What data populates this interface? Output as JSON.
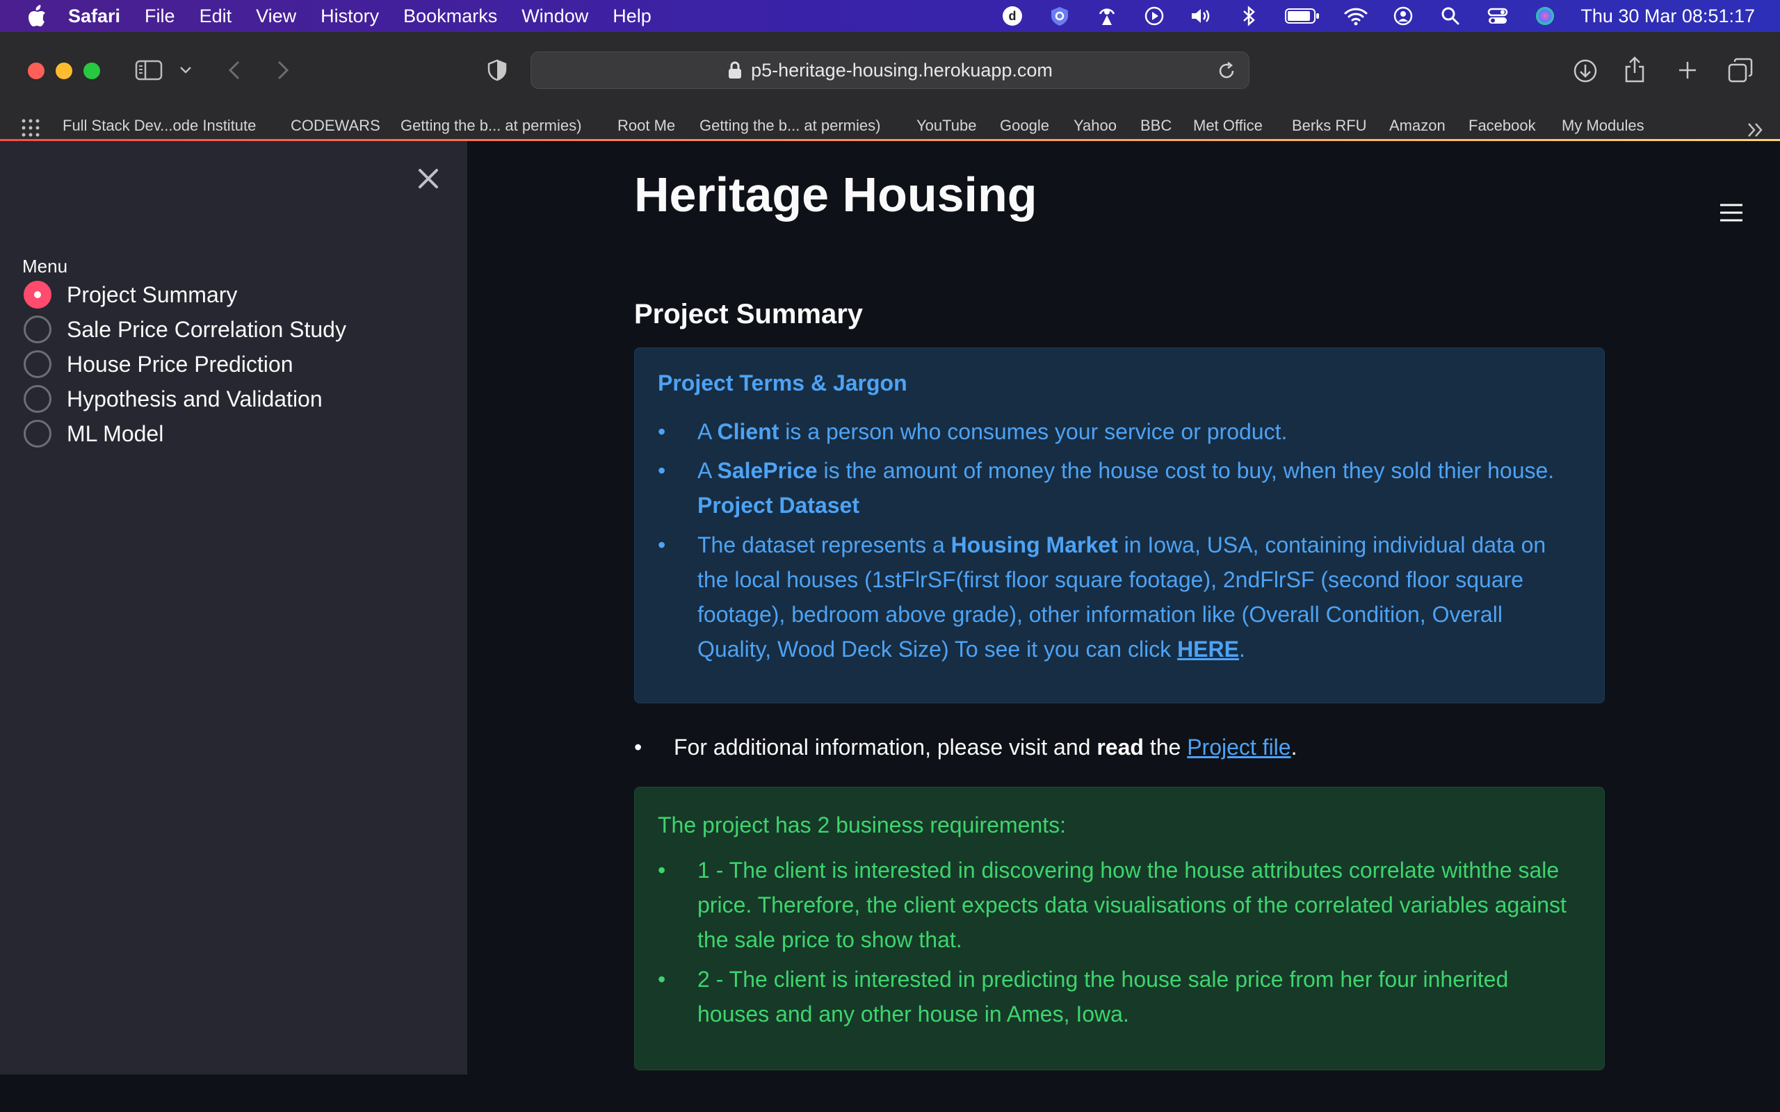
{
  "menubar": {
    "app_name": "Safari",
    "menus": [
      "File",
      "Edit",
      "View",
      "History",
      "Bookmarks",
      "Window",
      "Help"
    ],
    "clock": "Thu 30 Mar  08:51:17"
  },
  "browser": {
    "url": "p5-heritage-housing.herokuapp.com",
    "bookmarks": [
      "Full Stack Dev...ode Institute",
      "CODEWARS",
      "Getting the b... at permies)",
      "Root Me",
      "Getting the b... at permies)",
      "YouTube",
      "Google",
      "Yahoo",
      "BBC",
      "Met Office",
      "Berks RFU",
      "Amazon",
      "Facebook",
      "My Modules"
    ]
  },
  "sidebar": {
    "menu_label": "Menu",
    "items": [
      {
        "label": "Project Summary",
        "selected": true
      },
      {
        "label": "Sale Price Correlation Study",
        "selected": false
      },
      {
        "label": "House Price Prediction",
        "selected": false
      },
      {
        "label": "Hypothesis and Validation",
        "selected": false
      },
      {
        "label": "ML Model",
        "selected": false
      }
    ]
  },
  "main": {
    "title": "Heritage Housing",
    "subtitle": "Project Summary",
    "info": {
      "heading": "Project Terms & Jargon",
      "b1_pre": "A ",
      "b1_bold": "Client",
      "b1_post": " is a person who consumes your service or product.",
      "b2_pre": "A ",
      "b2_bold": "SalePrice",
      "b2_post": " is the amount of money the house cost to buy, when they sold thier house.",
      "dataset_heading": "Project Dataset",
      "b3_pre": "The dataset represents a ",
      "b3_bold": "Housing Market",
      "b3_post": " in Iowa, USA, containing individual data on the local houses (1stFlrSF(first floor square footage), 2ndFlrSF (second floor square footage), bedroom above grade), other information like (Overall Condition, Overall Quality, Wood Deck Size) To see it you can click ",
      "b3_link": "HERE",
      "b3_end": "."
    },
    "additional": {
      "pre": "For additional information, please visit and ",
      "bold": "read",
      "mid": " the ",
      "link": "Project file",
      "end": "."
    },
    "requirements": {
      "heading": "The project has 2 business requirements:",
      "r1": "1 - The client is interested in discovering how the house attributes correlate withthe sale price. Therefore, the client expects data visualisations of the correlated variables against the sale price to show that.",
      "r2": "2 - The client is interested in predicting the house sale price from her four inherited houses and any other house in Ames, Iowa."
    }
  }
}
